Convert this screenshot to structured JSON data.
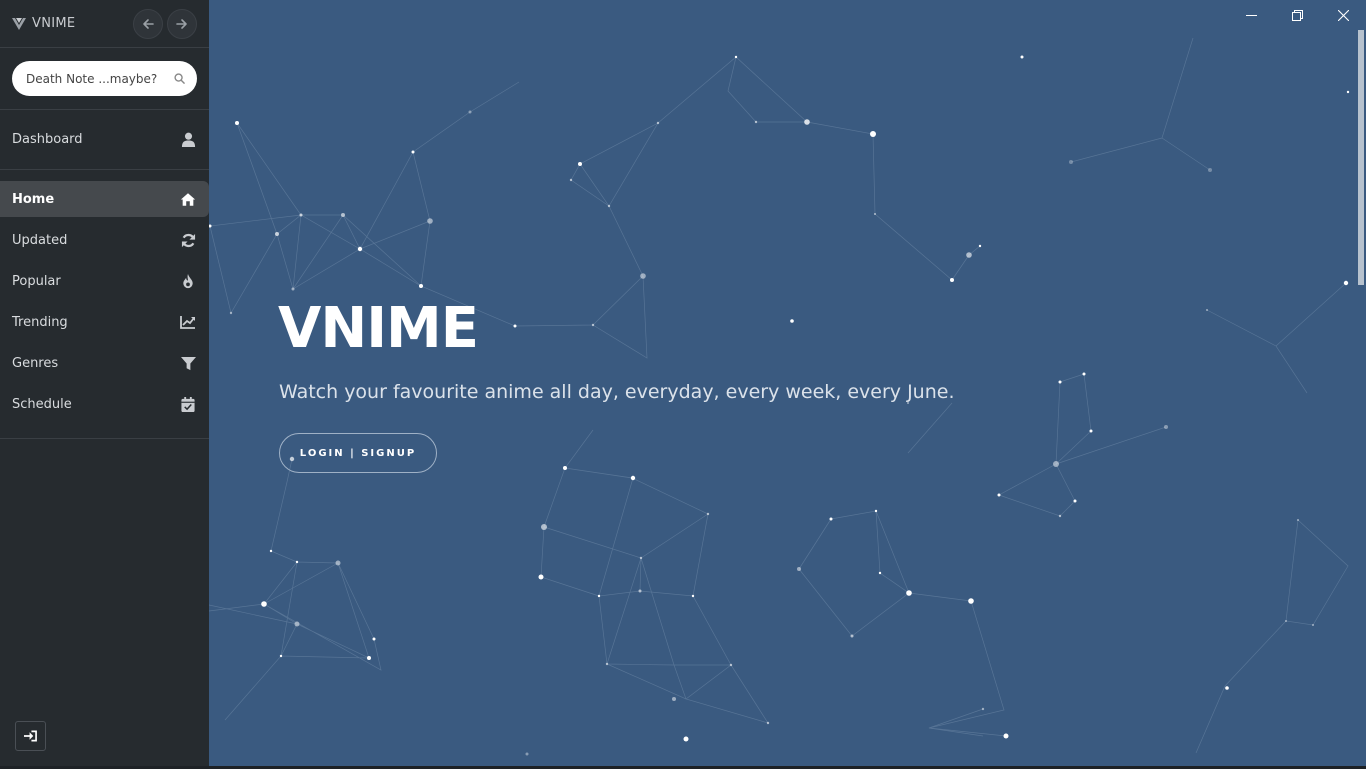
{
  "sidebar": {
    "brand": "VNIME",
    "search": {
      "placeholder": "Death Note ...maybe?",
      "value": ""
    },
    "dashboard": {
      "label": "Dashboard",
      "icon": "user-icon"
    },
    "items": [
      {
        "label": "Home",
        "icon": "home-icon",
        "active": true
      },
      {
        "label": "Updated",
        "icon": "refresh-icon",
        "active": false
      },
      {
        "label": "Popular",
        "icon": "fire-icon",
        "active": false
      },
      {
        "label": "Trending",
        "icon": "chart-line-icon",
        "active": false
      },
      {
        "label": "Genres",
        "icon": "filter-icon",
        "active": false
      },
      {
        "label": "Schedule",
        "icon": "calendar-icon",
        "active": false
      }
    ],
    "logout_icon": "sign-in-icon"
  },
  "hero": {
    "title": "VNIME",
    "subtitle": "Watch your favourite anime all day, everyday, every week, every June.",
    "cta_label": "LOGIN | SIGNUP"
  },
  "colors": {
    "sidebar_bg": "#262b2f",
    "main_bg": "#3a5a80",
    "active_item_bg": "#45494d",
    "text_light": "#ffffff"
  }
}
